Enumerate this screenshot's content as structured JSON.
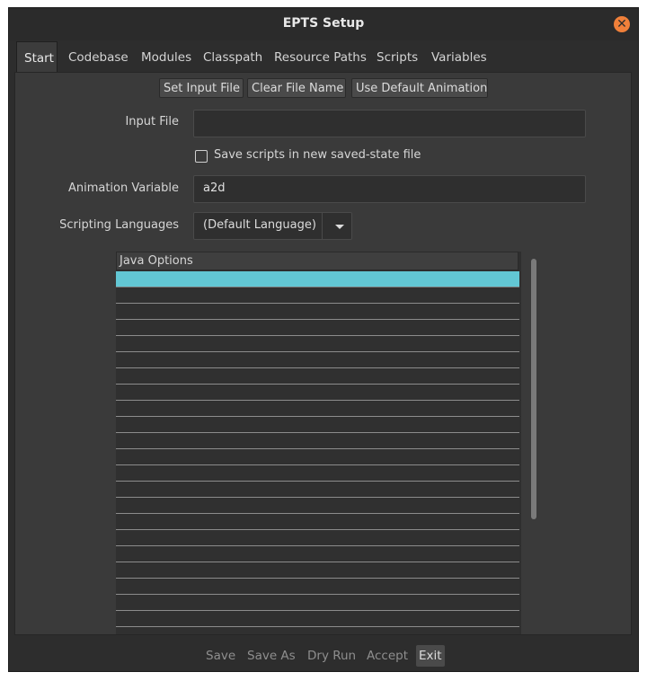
{
  "window": {
    "title": "EPTS Setup"
  },
  "tabs": [
    {
      "label": "Start"
    },
    {
      "label": "Codebase"
    },
    {
      "label": "Modules"
    },
    {
      "label": "Classpath"
    },
    {
      "label": "Resource Paths"
    },
    {
      "label": "Scripts"
    },
    {
      "label": "Variables"
    }
  ],
  "start": {
    "set_input_file": "Set Input File",
    "clear_file_name": "Clear File Name",
    "use_default_animation": "Use Default Animation",
    "input_file_label": "Input File",
    "input_file_value": "",
    "save_scripts_label": "Save scripts in new saved-state file",
    "save_scripts_checked": false,
    "animation_variable_label": "Animation Variable",
    "animation_variable_value": "a2d",
    "scripting_languages_label": "Scripting Languages",
    "scripting_language_selected": "(Default Language)",
    "java_options_header": "Java Options",
    "java_options_rows": [
      "",
      "",
      "",
      "",
      "",
      "",
      "",
      "",
      "",
      "",
      "",
      "",
      "",
      "",
      "",
      "",
      "",
      "",
      "",
      "",
      "",
      "",
      ""
    ],
    "selected_row": 0
  },
  "footer": {
    "save": "Save",
    "save_as": "Save As",
    "dry_run": "Dry Run",
    "accept": "Accept",
    "exit": "Exit"
  },
  "colors": {
    "selection": "#62c7d4",
    "close_button": "#f0803a"
  },
  "icons": {
    "close": "close-icon",
    "dropdown": "chevron-down-icon"
  }
}
